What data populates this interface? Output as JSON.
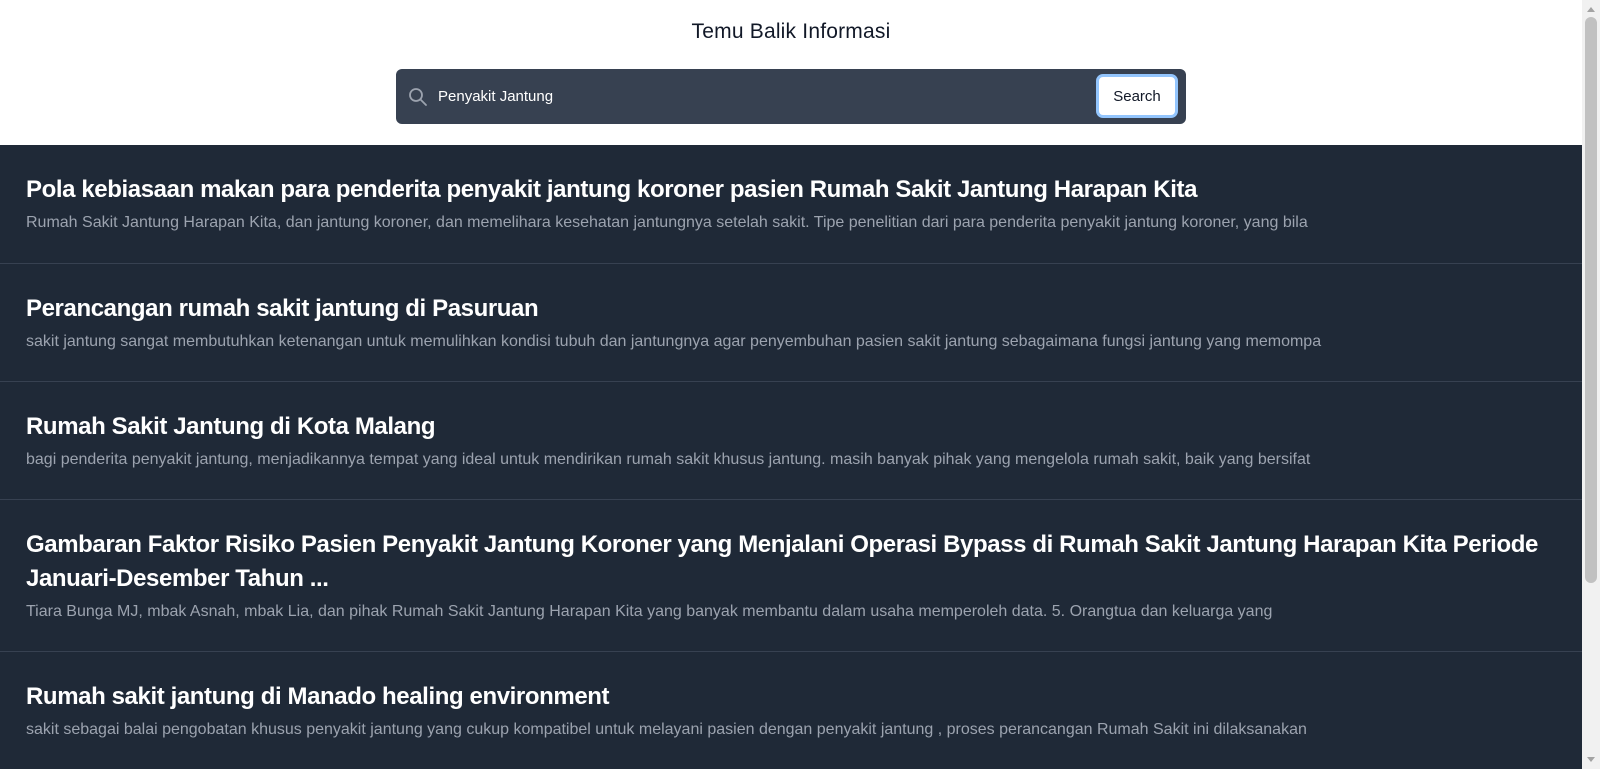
{
  "header": {
    "title": "Temu Balik Informasi"
  },
  "search": {
    "value": "Penyakit Jantung",
    "placeholder": "",
    "button_label": "Search"
  },
  "results": [
    {
      "title": "Pola kebiasaan makan para penderita penyakit jantung koroner pasien Rumah Sakit Jantung Harapan Kita",
      "snippet": "Rumah Sakit Jantung Harapan Kita, dan jantung koroner, dan memelihara kesehatan jantungnya setelah sakit. Tipe penelitian dari para penderita penyakit jantung koroner, yang bila"
    },
    {
      "title": "Perancangan rumah sakit jantung di Pasuruan",
      "snippet": "sakit jantung sangat membutuhkan ketenangan untuk memulihkan kondisi tubuh dan jantungnya agar penyembuhan pasien sakit jantung sebagaimana fungsi jantung yang memompa"
    },
    {
      "title": "Rumah Sakit Jantung di Kota Malang",
      "snippet": "bagi penderita penyakit jantung, menjadikannya tempat yang ideal untuk mendirikan rumah sakit khusus jantung. masih banyak pihak yang mengelola rumah sakit, baik yang bersifat"
    },
    {
      "title": "Gambaran Faktor Risiko Pasien Penyakit Jantung Koroner yang Menjalani Operasi Bypass di Rumah Sakit Jantung Harapan Kita Periode Januari-Desember Tahun ...",
      "snippet": "Tiara Bunga MJ, mbak Asnah, mbak Lia, dan pihak Rumah Sakit Jantung Harapan Kita yang banyak membantu dalam usaha memperoleh data. 5. Orangtua dan keluarga yang"
    },
    {
      "title": "Rumah sakit jantung di Manado healing environment",
      "snippet": "sakit sebagai balai pengobatan khusus penyakit jantung yang cukup kompatibel untuk melayani pasien dengan penyakit jantung , proses perancangan Rumah Sakit ini dilaksanakan"
    }
  ],
  "icons": {
    "search": "search-icon"
  },
  "colors": {
    "results_background": "#1f2937",
    "searchbar_background": "#374151",
    "title_text": "#ffffff",
    "snippet_text": "#9ca3af",
    "button_focus_ring": "#93c5fd"
  }
}
